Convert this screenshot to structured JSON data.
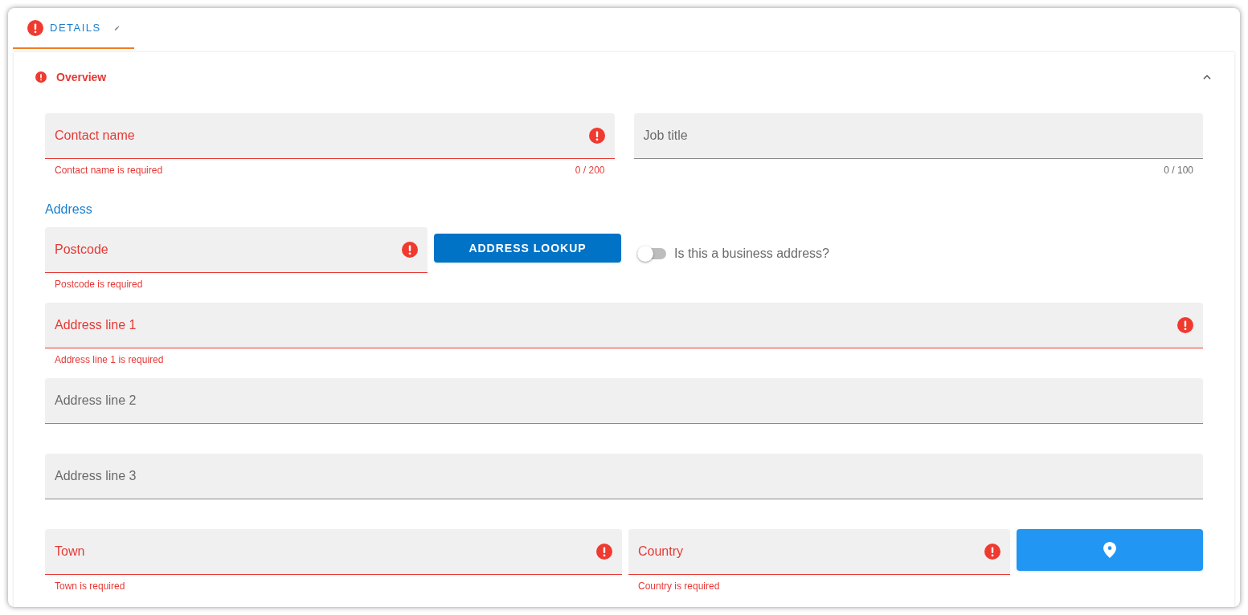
{
  "tab": {
    "label": "DETAILS",
    "selected": true,
    "has_error": true
  },
  "section": {
    "title": "Overview",
    "has_error": true,
    "expanded": true
  },
  "contact_name": {
    "label": "Contact name",
    "error": true,
    "message": "Contact name is required",
    "counter": "0 / 200"
  },
  "job_title": {
    "label": "Job title",
    "error": false,
    "counter": "0 / 100"
  },
  "address_heading": "Address",
  "postcode": {
    "label": "Postcode",
    "error": true,
    "message": "Postcode is required"
  },
  "lookup_button": {
    "label": "ADDRESS LOOKUP"
  },
  "business_toggle": {
    "label": "Is this a business address?",
    "on": false
  },
  "address_line_1": {
    "label": "Address line 1",
    "error": true,
    "message": "Address line 1 is required"
  },
  "address_line_2": {
    "label": "Address line 2",
    "error": false
  },
  "address_line_3": {
    "label": "Address line 3",
    "error": false
  },
  "town": {
    "label": "Town",
    "error": true,
    "message": "Town is required"
  },
  "country": {
    "label": "Country",
    "error": true,
    "message": "Country is required"
  }
}
